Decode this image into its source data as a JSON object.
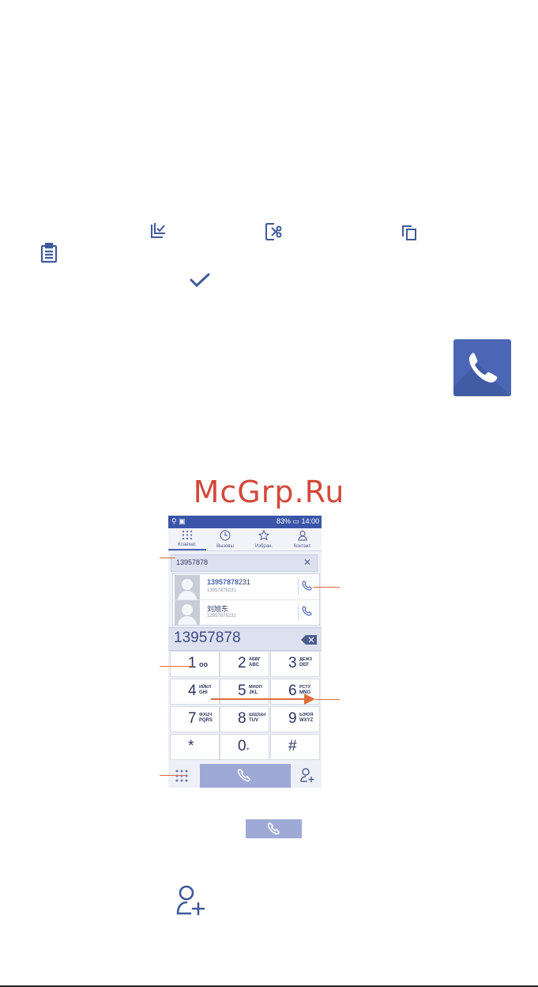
{
  "watermark": "McGrp.Ru",
  "icons": [
    "select-all-icon",
    "cut-icon",
    "copy-icon",
    "paste-icon",
    "check-icon",
    "phone-app-icon",
    "dial-call-icon",
    "add-contact-icon"
  ],
  "colors": {
    "accent": "#4a66b4",
    "status_bar": "#3b56a8",
    "callout": "#e06b3a",
    "watermark": "#d2493a"
  },
  "phone": {
    "status": {
      "battery": "83%",
      "time": "14:00"
    },
    "tabs": [
      {
        "label": "Клавиат.",
        "icon": "dialpad-icon"
      },
      {
        "label": "Вызовы",
        "icon": "clock-icon"
      },
      {
        "label": "Избран.",
        "icon": "star-icon"
      },
      {
        "label": "Контакт.",
        "icon": "person-icon"
      }
    ],
    "search_value": "13957878",
    "contacts": [
      {
        "match": "13957878",
        "rest": "231",
        "number": "13957878231"
      },
      {
        "name": "刘旭东",
        "number": "13957878231"
      }
    ],
    "dialed": "13957878",
    "keys": [
      {
        "digit": "1",
        "l1": "",
        "l2": "oo"
      },
      {
        "digit": "2",
        "l1": "АБВГ",
        "l2": "ABC"
      },
      {
        "digit": "3",
        "l1": "ДЕЖЗ",
        "l2": "DEF"
      },
      {
        "digit": "4",
        "l1": "ИЙКЛ",
        "l2": "GHI"
      },
      {
        "digit": "5",
        "l1": "МНОП",
        "l2": "JKL"
      },
      {
        "digit": "6",
        "l1": "РСТУ",
        "l2": "MNO"
      },
      {
        "digit": "7",
        "l1": "ФХЦЧ",
        "l2": "PQRS"
      },
      {
        "digit": "8",
        "l1": "ШЩЪЫ",
        "l2": "TUV"
      },
      {
        "digit": "9",
        "l1": "ЬЭЮЯ",
        "l2": "WXYZ"
      },
      {
        "digit": "*",
        "l1": "",
        "l2": ""
      },
      {
        "digit": "0",
        "l1": "",
        "l2": "+"
      },
      {
        "digit": "#",
        "l1": "",
        "l2": ""
      }
    ]
  }
}
